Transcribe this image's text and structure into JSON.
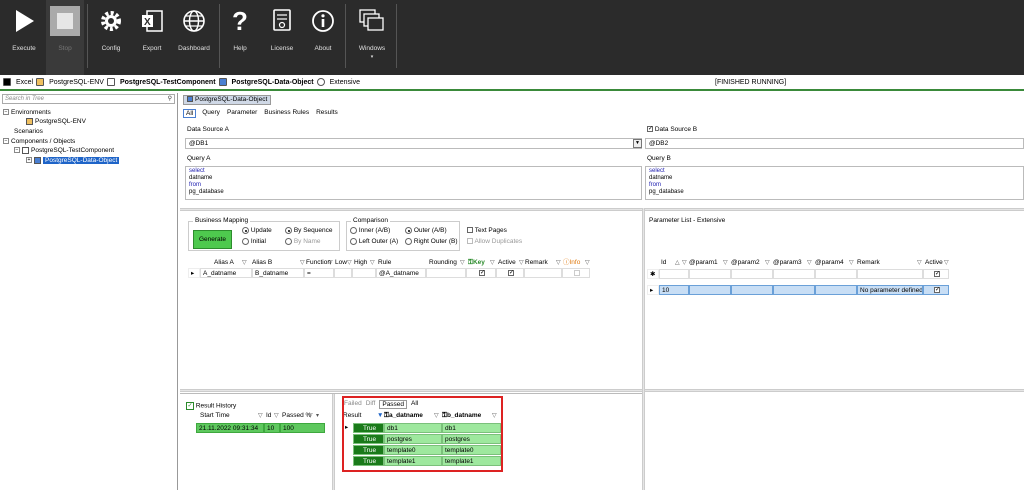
{
  "ribbon": {
    "buttons": [
      {
        "key": "execute",
        "label": "Execute"
      },
      {
        "key": "stop",
        "label": "Stop"
      },
      {
        "key": "config",
        "label": "Config"
      },
      {
        "key": "export",
        "label": "Export"
      },
      {
        "key": "dashboard",
        "label": "Dashboard"
      },
      {
        "key": "help",
        "label": "Help"
      },
      {
        "key": "license",
        "label": "License"
      },
      {
        "key": "about",
        "label": "About"
      },
      {
        "key": "windows",
        "label": "Windows"
      }
    ]
  },
  "breadcrumb": {
    "items": [
      "Excel",
      "PostgreSQL-ENV",
      "PostgreSQL-TestComponent",
      "PostgreSQL-Data-Object",
      "Extensive"
    ],
    "status": "[FINISHED RUNNING]"
  },
  "sidebar": {
    "search_placeholder": "Search in Tree",
    "tree": {
      "environments": "Environments",
      "env_child": "PostgreSQL-ENV",
      "scenarios": "Scenarios",
      "components": "Components / Objects",
      "component": "PostgreSQL-TestComponent",
      "object": "PostgreSQL-Data-Object"
    }
  },
  "main": {
    "doc_tab": "PostgreSQL-Data-Object",
    "subtabs": [
      "All",
      "Query",
      "Parameter",
      "Business Rules",
      "Results"
    ],
    "ds_a_label": "Data Source A",
    "ds_a_value": "@DB1",
    "ds_b_label": "Data Source B",
    "ds_b_value": "@DB2",
    "query_a_label": "Query A",
    "query_b_label": "Query B",
    "query_a": [
      "select",
      "datname",
      "from",
      "pg_database"
    ],
    "query_b": [
      "select",
      "datname",
      "from",
      "pg_database"
    ]
  },
  "mapping": {
    "group_title": "Business Mapping",
    "generate": "Generate",
    "update": "Update",
    "by_sequence": "By Sequence",
    "initial": "Initial",
    "by_name": "By Name",
    "comparison_title": "Comparison",
    "inner": "Inner (A/B)",
    "outer": "Outer (A/B)",
    "left_outer": "Left Outer (A)",
    "right_outer": "Right Outer (B)",
    "text_pages": "Text Pages",
    "allow_duplicates": "Allow Duplicates",
    "columns": [
      "Alias A",
      "Alias B",
      "Function",
      "Low",
      "High",
      "Rule",
      "Rounding",
      "Key",
      "Active",
      "Remark",
      "Info"
    ],
    "row": {
      "alias_a": "A_datname",
      "alias_b": "B_datname",
      "function": "=",
      "rule": "@A_datname"
    }
  },
  "params": {
    "title": "Parameter List - Extensive",
    "columns": [
      "Id",
      "@param1",
      "@param2",
      "@param3",
      "@param4",
      "Remark",
      "Active"
    ],
    "row": {
      "id": "10",
      "remark": "No parameter defined"
    }
  },
  "history": {
    "title": "Result History",
    "columns": [
      "Start Time",
      "Id",
      "Passed %"
    ],
    "row": {
      "start": "21.11.2022 09:31:34",
      "id": "10",
      "passed": "100"
    }
  },
  "results": {
    "tabs": [
      "Failed",
      "Diff",
      "Passed",
      "All"
    ],
    "columns": [
      "Result",
      "a_datname",
      "b_datname"
    ],
    "rows": [
      {
        "result": "True",
        "a": "db1",
        "b": "db1"
      },
      {
        "result": "True",
        "a": "postgres",
        "b": "postgres"
      },
      {
        "result": "True",
        "a": "template0",
        "b": "template0"
      },
      {
        "result": "True",
        "a": "template1",
        "b": "template1"
      }
    ]
  },
  "colors": {
    "ribbon_bg": "#2b2b2b",
    "accent_green": "#3a8a3a",
    "row_green": "#5ec85e",
    "highlight_red": "#dd2222"
  }
}
